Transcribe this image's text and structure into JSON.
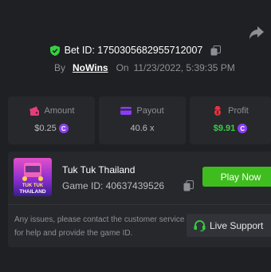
{
  "bet": {
    "id_label": "Bet ID: 1750305682955712007",
    "by_label": "By",
    "username": "NoWins",
    "on_label": "On",
    "datetime": "11/23/2022, 5:39:35 PM"
  },
  "stats": [
    {
      "label": "Amount",
      "value": "$0.25",
      "icon": "wallet-icon",
      "coin": true
    },
    {
      "label": "Payout",
      "value": "40.6 x",
      "icon": "payout-icon",
      "coin": false
    },
    {
      "label": "Profit",
      "value": "$9.91",
      "icon": "profit-icon",
      "coin": true
    }
  ],
  "coin_symbol": "C",
  "game": {
    "title": "Tuk Tuk Thailand",
    "game_id_label": "Game ID: 40637439526",
    "thumb_top": "TUK TUK",
    "thumb_bottom": "THAILAND",
    "play_label": "Play Now"
  },
  "support": {
    "help_text": "Any issues, please contact the customer service for help and provide the game ID.",
    "button_label": "Live Support"
  },
  "colors": {
    "background": "#1f2023",
    "card": "#27282c",
    "play_green": "#3fbd1e",
    "profit_green": "#35d043",
    "coin_purple": "#8b3df5",
    "amount_pink": "#e63d7a",
    "profit_red": "#e0353f"
  }
}
